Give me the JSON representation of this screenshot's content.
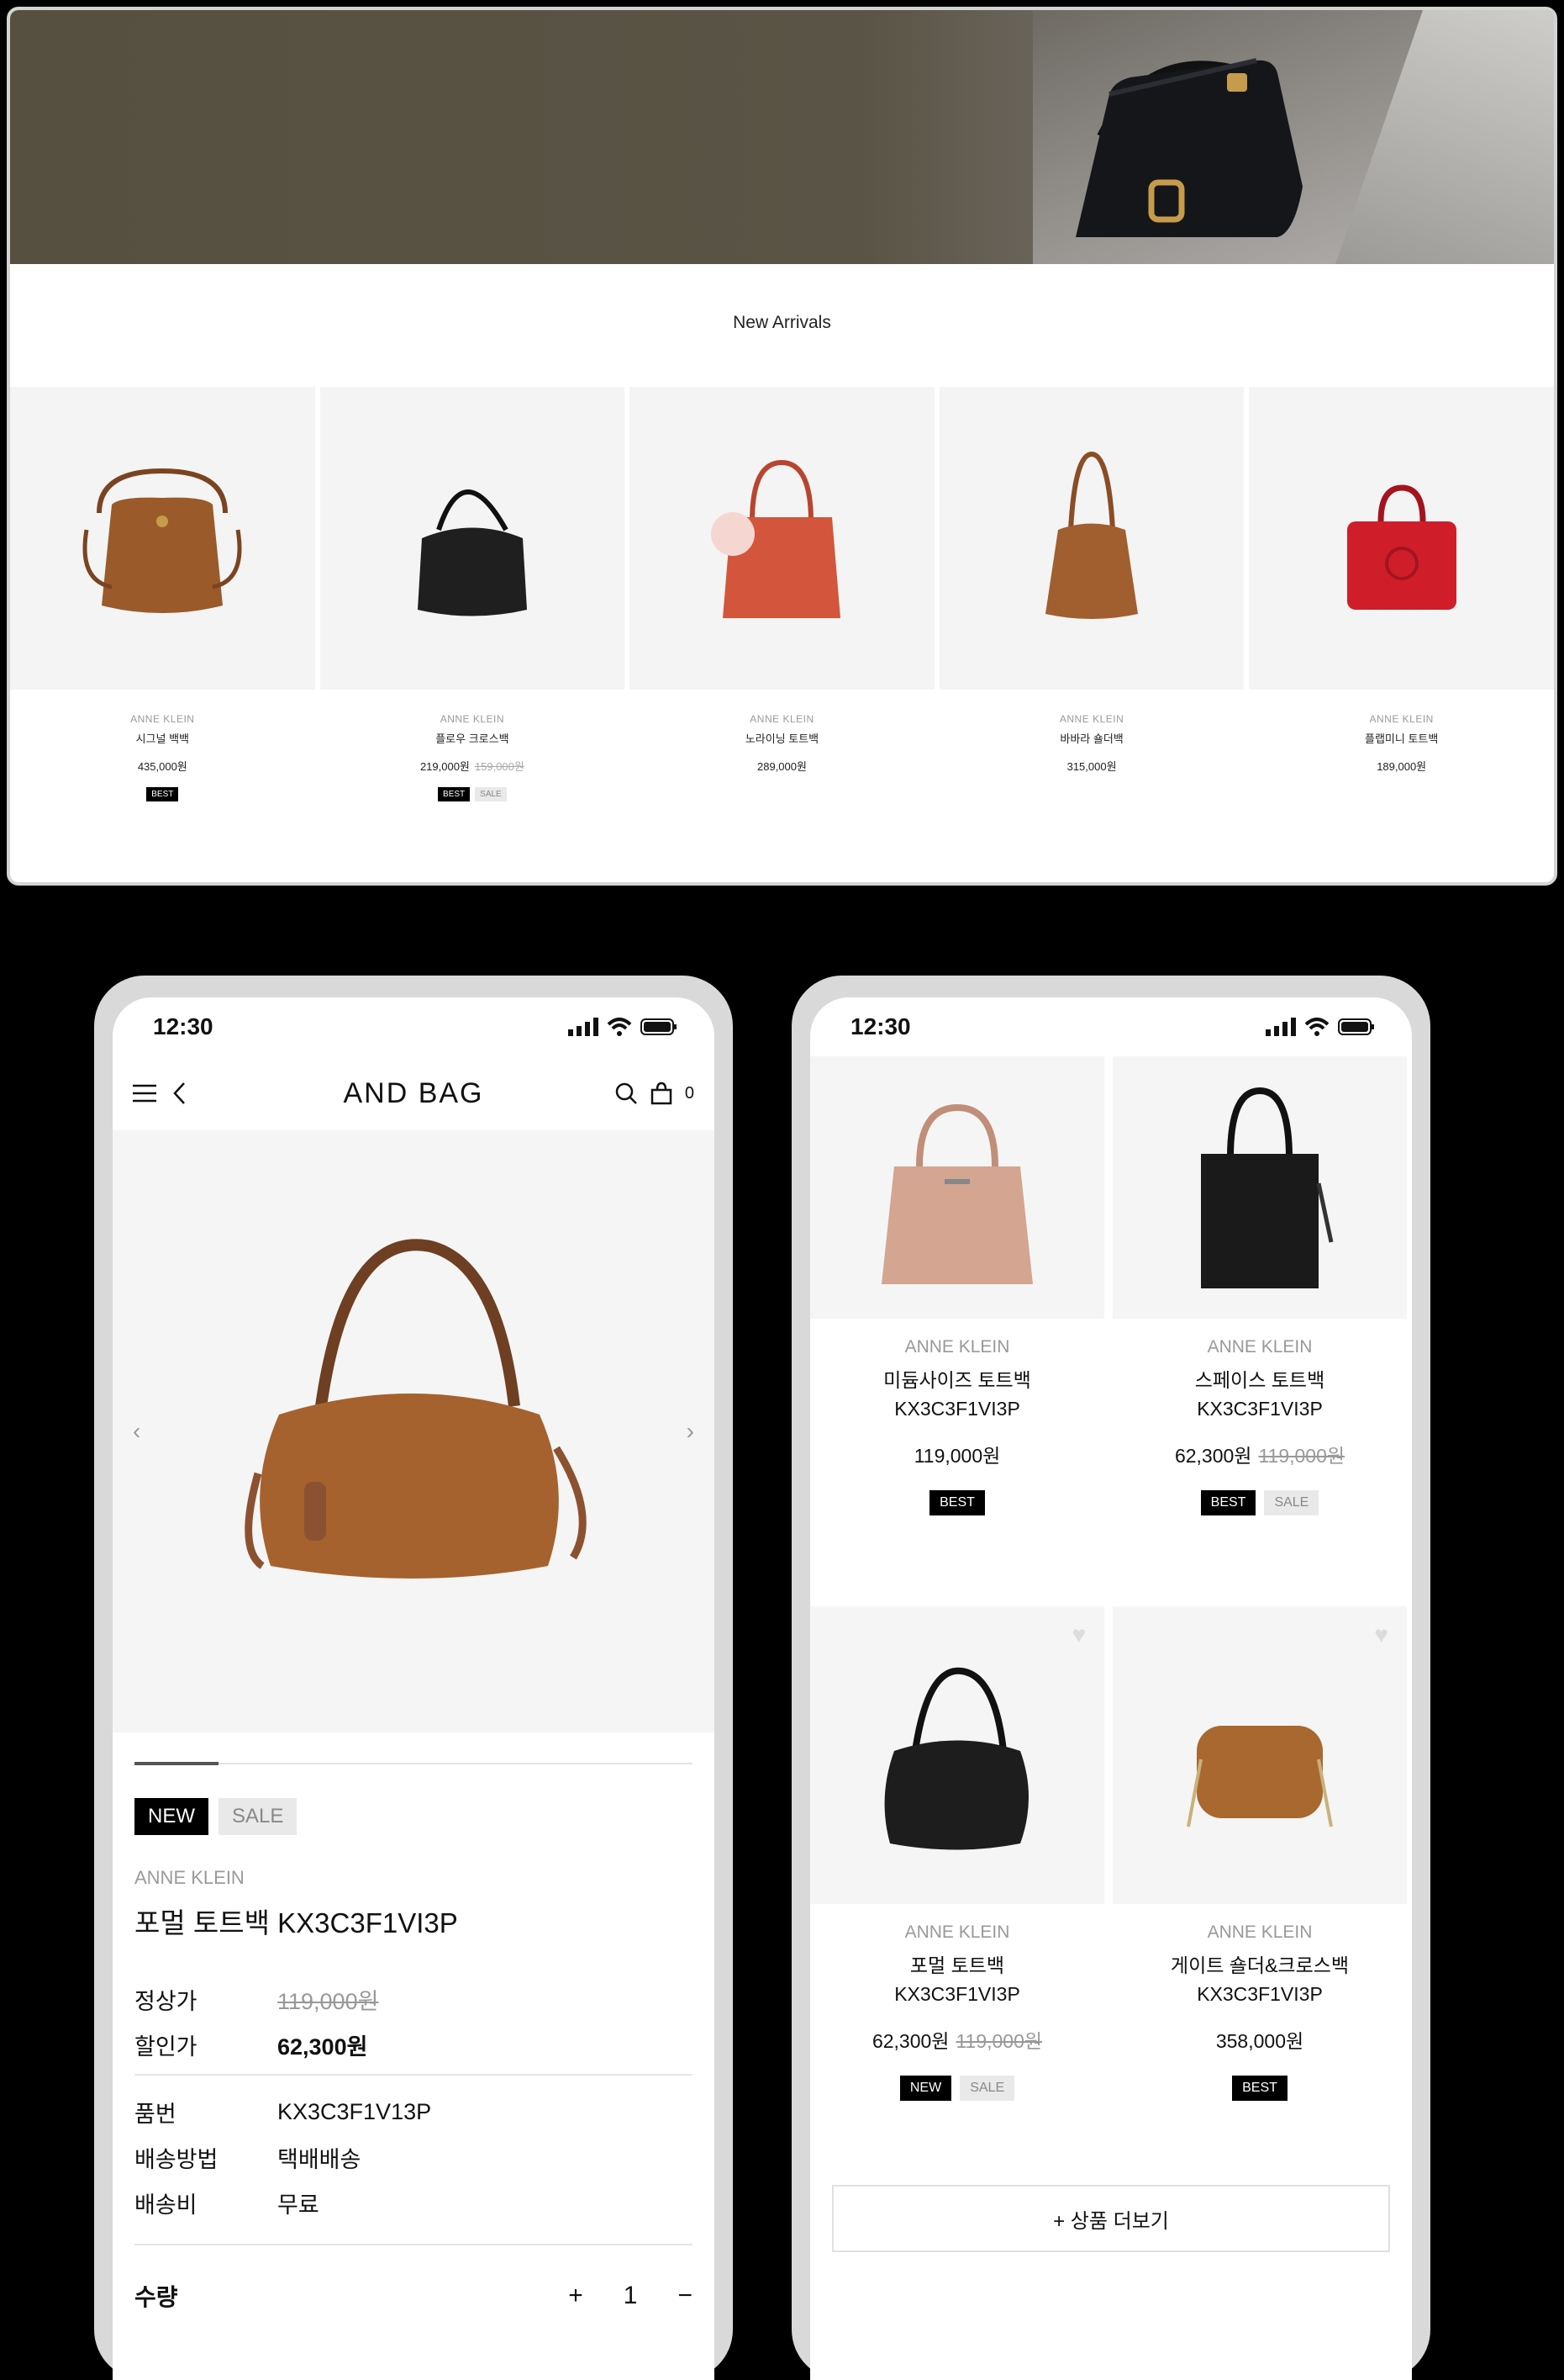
{
  "desktop": {
    "section_title": "New Arrivals",
    "products": [
      {
        "brand": "ANNE KLEIN",
        "name": "시그널 백백",
        "price": "435,000원",
        "old_price": "",
        "badges": [
          "BEST"
        ],
        "color": "#9b5a2a"
      },
      {
        "brand": "ANNE KLEIN",
        "name": "플로우 크로스백",
        "price": "219,000원",
        "old_price": "159,000원",
        "badges": [
          "BEST",
          "SALE"
        ],
        "color": "#1f1f1f"
      },
      {
        "brand": "ANNE KLEIN",
        "name": "노라이닝 토트백",
        "price": "289,000원",
        "old_price": "",
        "badges": [],
        "color": "#d2553c"
      },
      {
        "brand": "ANNE KLEIN",
        "name": "바바라 숄더백",
        "price": "315,000원",
        "old_price": "",
        "badges": [],
        "color": "#a15e2e"
      },
      {
        "brand": "ANNE KLEIN",
        "name": "플랩미니 토트백",
        "price": "189,000원",
        "old_price": "",
        "badges": [],
        "color": "#cf1e2a"
      }
    ]
  },
  "detail": {
    "time": "12:30",
    "title": "AND BAG",
    "cart_count": "0",
    "badges": [
      "NEW",
      "SALE"
    ],
    "brand": "ANNE KLEIN",
    "name": "포멀 토트백 KX3C3F1VI3P",
    "regular_label": "정상가",
    "regular_price": "119,000원",
    "sale_label": "할인가",
    "sale_price": "62,300원",
    "code_label": "품번",
    "code": "KX3C3F1V13P",
    "shipping_label": "배송방법",
    "shipping": "택배배송",
    "fee_label": "배송비",
    "fee": "무료",
    "qty_label": "수량",
    "qty": "1",
    "plus": "+",
    "minus": "−"
  },
  "list": {
    "time": "12:30",
    "products": [
      {
        "brand": "ANNE KLEIN",
        "name": "미듐사이즈 토트백",
        "code": "KX3C3F1VI3P",
        "price": "119,000원",
        "old_price": "",
        "badges": [
          "BEST"
        ],
        "color": "#d4a590"
      },
      {
        "brand": "ANNE KLEIN",
        "name": "스페이스 토트백",
        "code": "KX3C3F1VI3P",
        "price": "62,300원",
        "old_price": "119,000원",
        "badges": [
          "BEST",
          "SALE"
        ],
        "color": "#1a1a1a"
      },
      {
        "brand": "ANNE KLEIN",
        "name": "포멀 토트백",
        "code": "KX3C3F1VI3P",
        "price": "62,300원",
        "old_price": "119,000원",
        "badges": [
          "NEW",
          "SALE"
        ],
        "color": "#1d1d1d"
      },
      {
        "brand": "ANNE KLEIN",
        "name": "게이트 숄더&크로스백",
        "code": "KX3C3F1VI3P",
        "price": "358,000원",
        "old_price": "",
        "badges": [
          "BEST"
        ],
        "color": "#a9682f"
      }
    ],
    "more_label": "+ 상품 더보기"
  }
}
